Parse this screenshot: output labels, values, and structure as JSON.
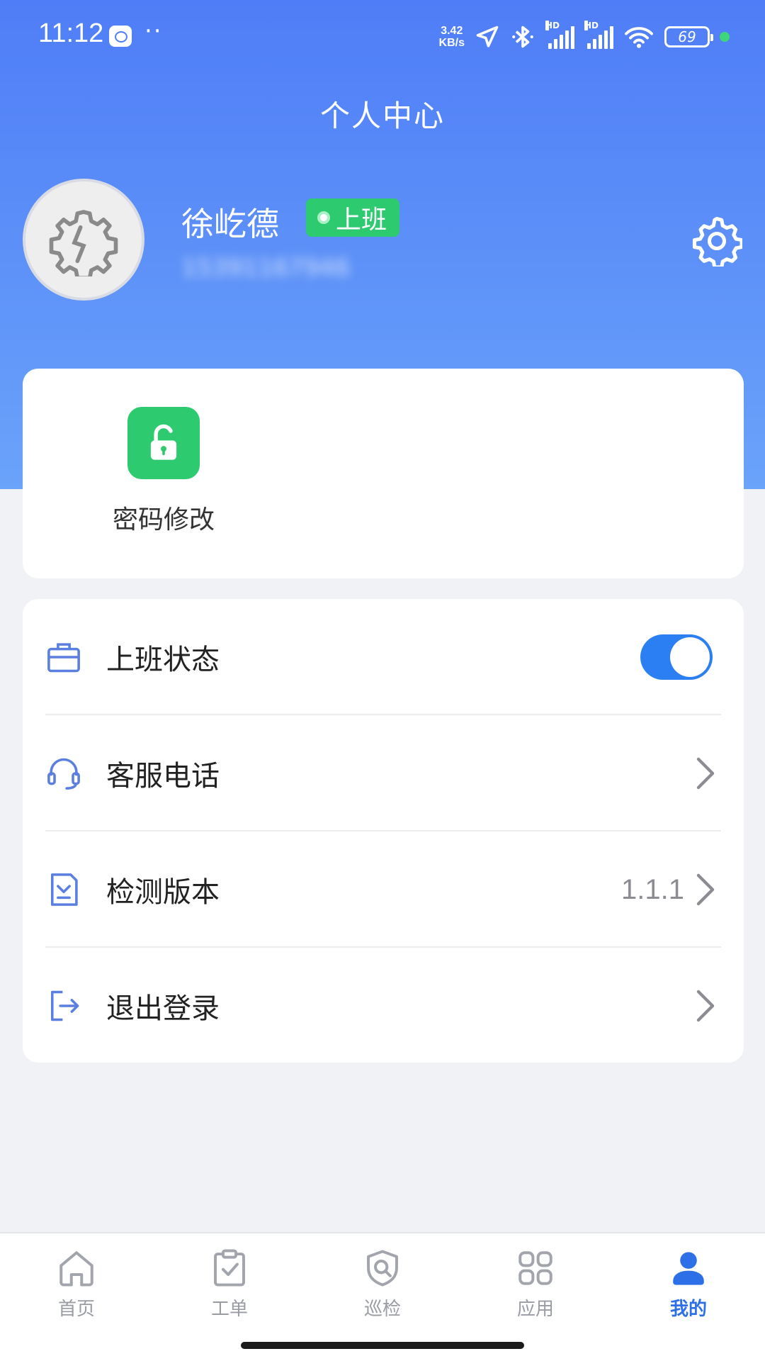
{
  "status_bar": {
    "time": "11:12",
    "dots": "··",
    "speed_top": "3.42",
    "speed_bottom": "KB/s",
    "hd": "HD",
    "battery": "69"
  },
  "header": {
    "title": "个人中心"
  },
  "profile": {
    "name": "徐屹德",
    "status_badge": "上班",
    "phone": "15391167946",
    "settings_icon": "gear-icon",
    "avatar_icon": "broken-gear-icon"
  },
  "quick_actions": [
    {
      "label": "密码修改",
      "icon": "unlock-icon",
      "color": "#2dca6f"
    }
  ],
  "menu": {
    "items": [
      {
        "label": "上班状态",
        "icon": "briefcase-icon",
        "control": "toggle",
        "on": true
      },
      {
        "label": "客服电话",
        "icon": "headset-icon",
        "control": "chevron"
      },
      {
        "label": "检测版本",
        "icon": "download-doc-icon",
        "control": "chevron",
        "value": "1.1.1"
      },
      {
        "label": "退出登录",
        "icon": "logout-icon",
        "control": "chevron"
      }
    ]
  },
  "tabs": [
    {
      "label": "首页",
      "icon": "home-icon",
      "active": false
    },
    {
      "label": "工单",
      "icon": "clipboard-icon",
      "active": false
    },
    {
      "label": "巡检",
      "icon": "shield-search-icon",
      "active": false
    },
    {
      "label": "应用",
      "icon": "grid-icon",
      "active": false
    },
    {
      "label": "我的",
      "icon": "user-icon",
      "active": true
    }
  ],
  "colors": {
    "header_gradient_top": "#4f7df7",
    "accent_blue": "#2b7ff3",
    "green": "#2dca6f",
    "active_tab": "#2d6fe6",
    "icon_blue": "#5b7fe0"
  }
}
